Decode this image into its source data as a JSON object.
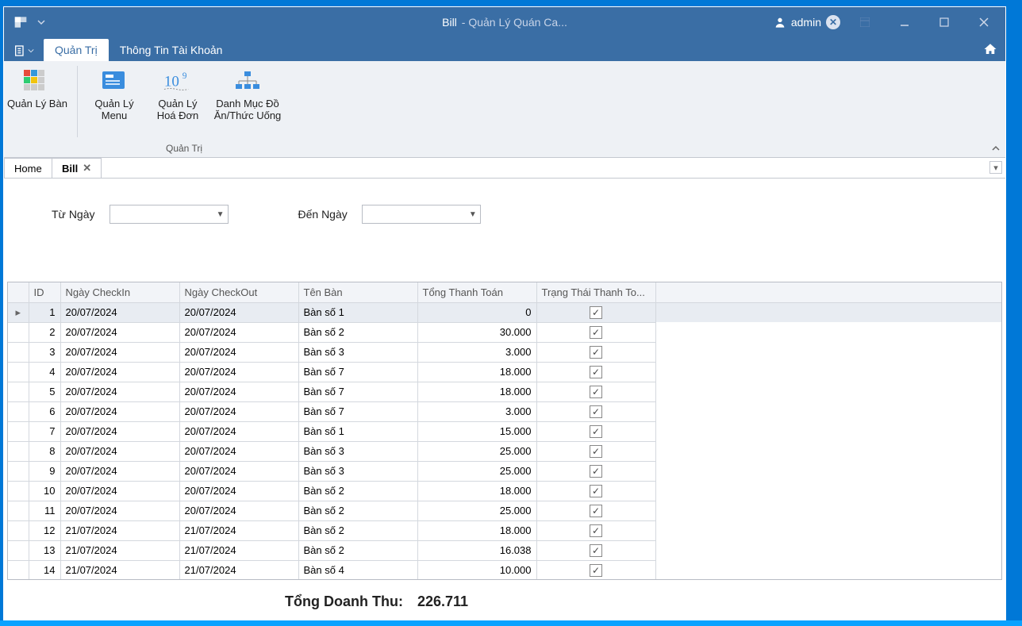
{
  "title": {
    "document": "Bill",
    "app": "- Quản Lý Quán Ca..."
  },
  "user": {
    "name": "admin"
  },
  "ribbon": {
    "tabs": [
      {
        "label": "Quản Trị"
      },
      {
        "label": "Thông Tin Tài Khoản"
      }
    ],
    "buttons": [
      {
        "label": "Quản Lý Bàn"
      },
      {
        "line1": "Quản Lý",
        "line2": "Menu"
      },
      {
        "line1": "Quản Lý",
        "line2": "Hoá Đơn"
      },
      {
        "line1": "Danh Mục Đồ",
        "line2": "Ăn/Thức Uống"
      }
    ],
    "group_label": "Quản Trị"
  },
  "doc_tabs": [
    {
      "label": "Home"
    },
    {
      "label": "Bill"
    }
  ],
  "filters": {
    "from_label": "Từ Ngày",
    "to_label": "Đến Ngày"
  },
  "grid": {
    "headers": [
      "ID",
      "Ngày CheckIn",
      "Ngày CheckOut",
      "Tên Bàn",
      "Tổng Thanh Toán",
      "Trạng Thái Thanh To..."
    ],
    "rows": [
      {
        "id": 1,
        "checkin": "20/07/2024",
        "checkout": "20/07/2024",
        "table": "Bàn số 1",
        "total": "0",
        "paid": true,
        "selected": true
      },
      {
        "id": 2,
        "checkin": "20/07/2024",
        "checkout": "20/07/2024",
        "table": "Bàn số 2",
        "total": "30.000",
        "paid": true
      },
      {
        "id": 3,
        "checkin": "20/07/2024",
        "checkout": "20/07/2024",
        "table": "Bàn số 3",
        "total": "3.000",
        "paid": true
      },
      {
        "id": 4,
        "checkin": "20/07/2024",
        "checkout": "20/07/2024",
        "table": "Bàn số 7",
        "total": "18.000",
        "paid": true
      },
      {
        "id": 5,
        "checkin": "20/07/2024",
        "checkout": "20/07/2024",
        "table": "Bàn số 7",
        "total": "18.000",
        "paid": true
      },
      {
        "id": 6,
        "checkin": "20/07/2024",
        "checkout": "20/07/2024",
        "table": "Bàn số 7",
        "total": "3.000",
        "paid": true
      },
      {
        "id": 7,
        "checkin": "20/07/2024",
        "checkout": "20/07/2024",
        "table": "Bàn số 1",
        "total": "15.000",
        "paid": true
      },
      {
        "id": 8,
        "checkin": "20/07/2024",
        "checkout": "20/07/2024",
        "table": "Bàn số 3",
        "total": "25.000",
        "paid": true
      },
      {
        "id": 9,
        "checkin": "20/07/2024",
        "checkout": "20/07/2024",
        "table": "Bàn số 3",
        "total": "25.000",
        "paid": true
      },
      {
        "id": 10,
        "checkin": "20/07/2024",
        "checkout": "20/07/2024",
        "table": "Bàn số 2",
        "total": "18.000",
        "paid": true
      },
      {
        "id": 11,
        "checkin": "20/07/2024",
        "checkout": "20/07/2024",
        "table": "Bàn số 2",
        "total": "25.000",
        "paid": true
      },
      {
        "id": 12,
        "checkin": "21/07/2024",
        "checkout": "21/07/2024",
        "table": "Bàn số 2",
        "total": "18.000",
        "paid": true
      },
      {
        "id": 13,
        "checkin": "21/07/2024",
        "checkout": "21/07/2024",
        "table": "Bàn số 2",
        "total": "16.038",
        "paid": true
      },
      {
        "id": 14,
        "checkin": "21/07/2024",
        "checkout": "21/07/2024",
        "table": "Bàn số 4",
        "total": "10.000",
        "paid": true
      }
    ]
  },
  "summary": {
    "label": "Tổng Doanh Thu:",
    "value": "226.711"
  }
}
